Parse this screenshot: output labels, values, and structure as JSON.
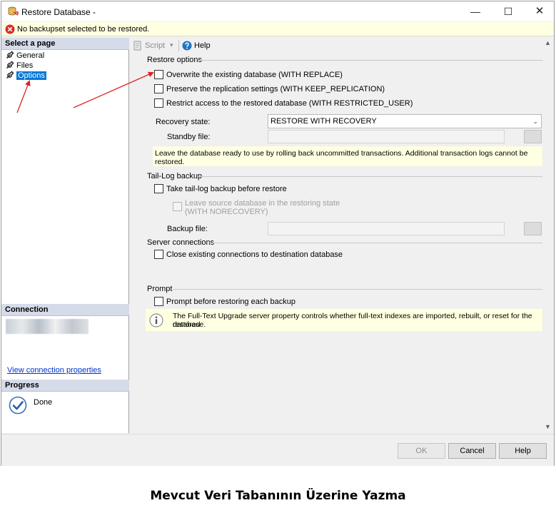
{
  "window": {
    "title": "Restore Database -",
    "minimize_glyph": "—",
    "maximize_glyph": "☐",
    "close_glyph": "✕"
  },
  "error_bar": {
    "text": "No backupset selected to be restored."
  },
  "left_pane": {
    "select_page_header": "Select a page",
    "pages": [
      {
        "label": "General",
        "selected": false
      },
      {
        "label": "Files",
        "selected": false
      },
      {
        "label": "Options",
        "selected": true
      }
    ],
    "connection_header": "Connection",
    "view_connection_link": "View connection properties",
    "progress_header": "Progress",
    "progress_status": "Done"
  },
  "toolbar": {
    "script_label": "Script",
    "script_dropdown_glyph": "▾",
    "help_label": "Help"
  },
  "restore_options": {
    "group_label": "Restore options",
    "overwrite": {
      "label": "Overwrite the existing database (WITH REPLACE)",
      "checked": false
    },
    "preserve_replication": {
      "label": "Preserve the replication settings (WITH KEEP_REPLICATION)",
      "checked": false
    },
    "restrict_access": {
      "label": "Restrict access to the restored database (WITH RESTRICTED_USER)",
      "checked": false
    },
    "recovery_state_label": "Recovery state:",
    "recovery_state_value": "RESTORE WITH RECOVERY",
    "combo_arrow_glyph": "⌄",
    "standby_file_label": "Standby file:",
    "recovery_note": "Leave the database ready to use by rolling back uncommitted transactions. Additional transaction logs cannot be restored."
  },
  "tail_log": {
    "group_label": "Tail-Log backup",
    "take_tail_log": {
      "label": "Take tail-log backup before restore",
      "checked": false
    },
    "leave_norecovery": {
      "label_line1": "Leave source database in the restoring state",
      "label_line2": "(WITH NORECOVERY)",
      "checked": false,
      "enabled": false
    },
    "backup_file_label": "Backup file:"
  },
  "server_connections": {
    "group_label": "Server connections",
    "close_existing": {
      "label": "Close existing connections to destination database",
      "checked": false
    }
  },
  "prompt": {
    "group_label": "Prompt",
    "prompt_before": {
      "label": "Prompt before restoring each backup",
      "checked": false
    },
    "info_note_line1": "The Full-Text Upgrade server property controls whether full-text indexes are imported, rebuilt, or reset for the restored",
    "info_note_line2": "database."
  },
  "scrollbar": {
    "up_glyph": "▲",
    "down_glyph": "▼"
  },
  "footer": {
    "ok_label": "OK",
    "cancel_label": "Cancel",
    "help_label": "Help"
  },
  "caption": "Mevcut Veri Tabanının Üzerine Yazma",
  "colors": {
    "selection": "#0078d7",
    "annotation_arrow": "#e02020",
    "error": "#d92b2b",
    "help_icon": "#1e73c7",
    "note_background": "#ffffe1"
  }
}
